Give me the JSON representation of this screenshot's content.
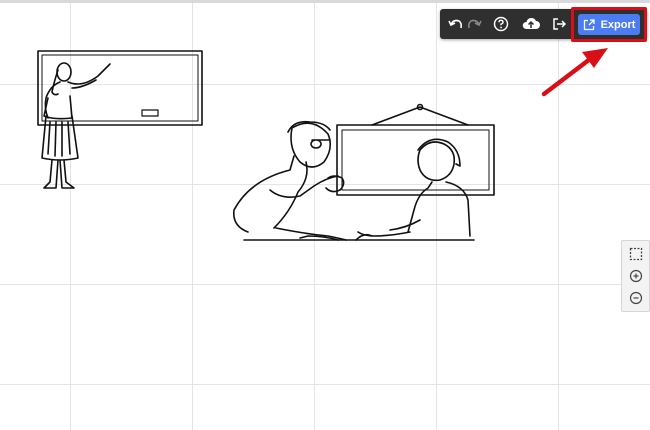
{
  "toolbar": {
    "export_label": "Export",
    "buttons": [
      "undo-icon",
      "redo-icon",
      "help-icon",
      "upload-icon",
      "sign-out-icon"
    ]
  },
  "zoom": {
    "buttons": [
      "fit-selection-icon",
      "zoom-in-icon",
      "zoom-out-icon"
    ]
  },
  "colors": {
    "toolbar_bg": "#2f2f2f",
    "export_bg": "#4b7cf2",
    "highlight": "#d80f16"
  }
}
